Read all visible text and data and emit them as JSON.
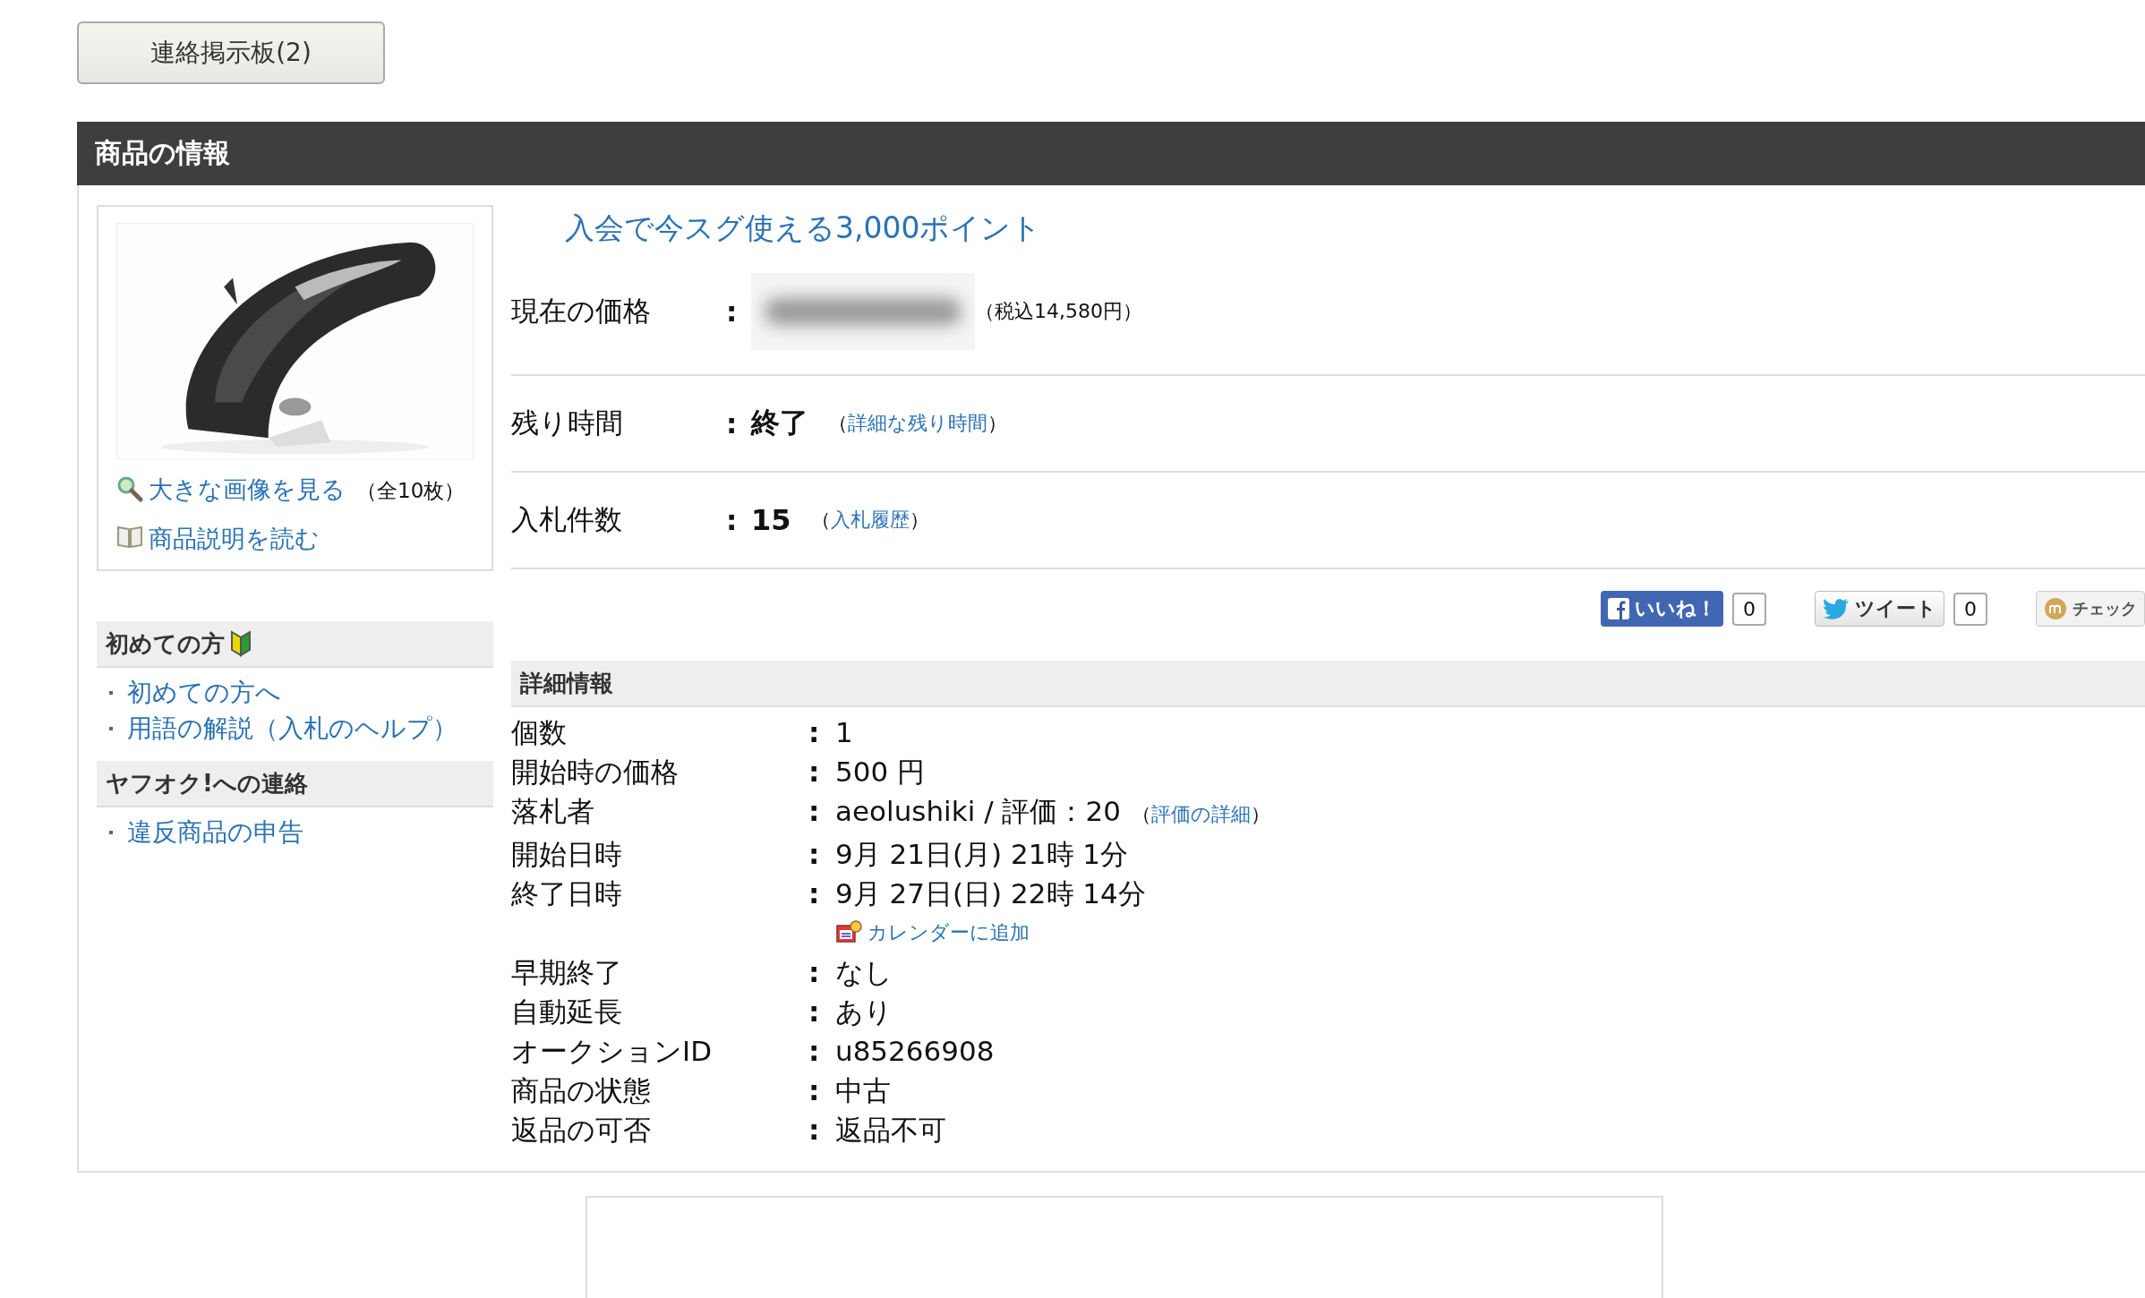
{
  "board_button": "連絡掲示板(2)",
  "section_title": "商品の情報",
  "image_links": [
    {
      "kind": "zoom",
      "label": "大きな画像を見る",
      "note": "（全10枚）"
    },
    {
      "kind": "book",
      "label": "商品説明を読む"
    }
  ],
  "promo_link": "入会で今スグ使える3,000ポイント",
  "summary": [
    {
      "kind": "price",
      "label": "現在の価格",
      "separator": ":",
      "note": "（税込14,580円）"
    },
    {
      "kind": "status",
      "label": "残り時間",
      "separator": ":",
      "value": "終了",
      "open": "（",
      "link": "詳細な残り時間",
      "close": "）"
    },
    {
      "kind": "status",
      "label": "入札件数",
      "separator": ":",
      "value": "15",
      "open": "（",
      "link": "入札履歴",
      "close": "）"
    }
  ],
  "social": [
    {
      "kind": "facebook",
      "label": "いいね！",
      "count": "0"
    },
    {
      "kind": "twitter",
      "label": "ツイート",
      "count": "0"
    },
    {
      "kind": "mixi",
      "label": "チェック"
    }
  ],
  "sidebar": [
    {
      "title": "初めての方",
      "beginner_mark": true,
      "items": [
        "初めての方へ",
        "用語の解説（入札のヘルプ）"
      ]
    },
    {
      "title": "ヤフオク!への連絡",
      "beginner_mark": false,
      "items": [
        "違反商品の申告"
      ]
    }
  ],
  "details_title": "詳細情報",
  "details": [
    {
      "kind": "row",
      "label": "個数",
      "separator": ":",
      "value": "1"
    },
    {
      "kind": "row",
      "label": "開始時の価格",
      "separator": ":",
      "value": "500 円"
    },
    {
      "kind": "row",
      "label": "落札者",
      "separator": ":",
      "value": "aeolushiki / 評価：20",
      "open": "（",
      "link": "評価の詳細",
      "close": "）"
    },
    {
      "kind": "row",
      "label": "開始日時",
      "separator": ":",
      "value": "9月 21日(月) 21時 1分"
    },
    {
      "kind": "row",
      "label": "終了日時",
      "separator": ":",
      "value": "9月 27日(日) 22時 14分"
    },
    {
      "kind": "calendar",
      "link": "カレンダーに追加"
    },
    {
      "kind": "row",
      "label": "早期終了",
      "separator": ":",
      "value": "なし"
    },
    {
      "kind": "row",
      "label": "自動延長",
      "separator": ":",
      "value": "あり"
    },
    {
      "kind": "row",
      "label": "オークションID",
      "separator": ":",
      "value": "u85266908"
    },
    {
      "kind": "row",
      "label": "商品の状態",
      "separator": ":",
      "value": "中古"
    },
    {
      "kind": "row",
      "label": "返品の可否",
      "separator": ":",
      "value": "返品不可"
    }
  ]
}
